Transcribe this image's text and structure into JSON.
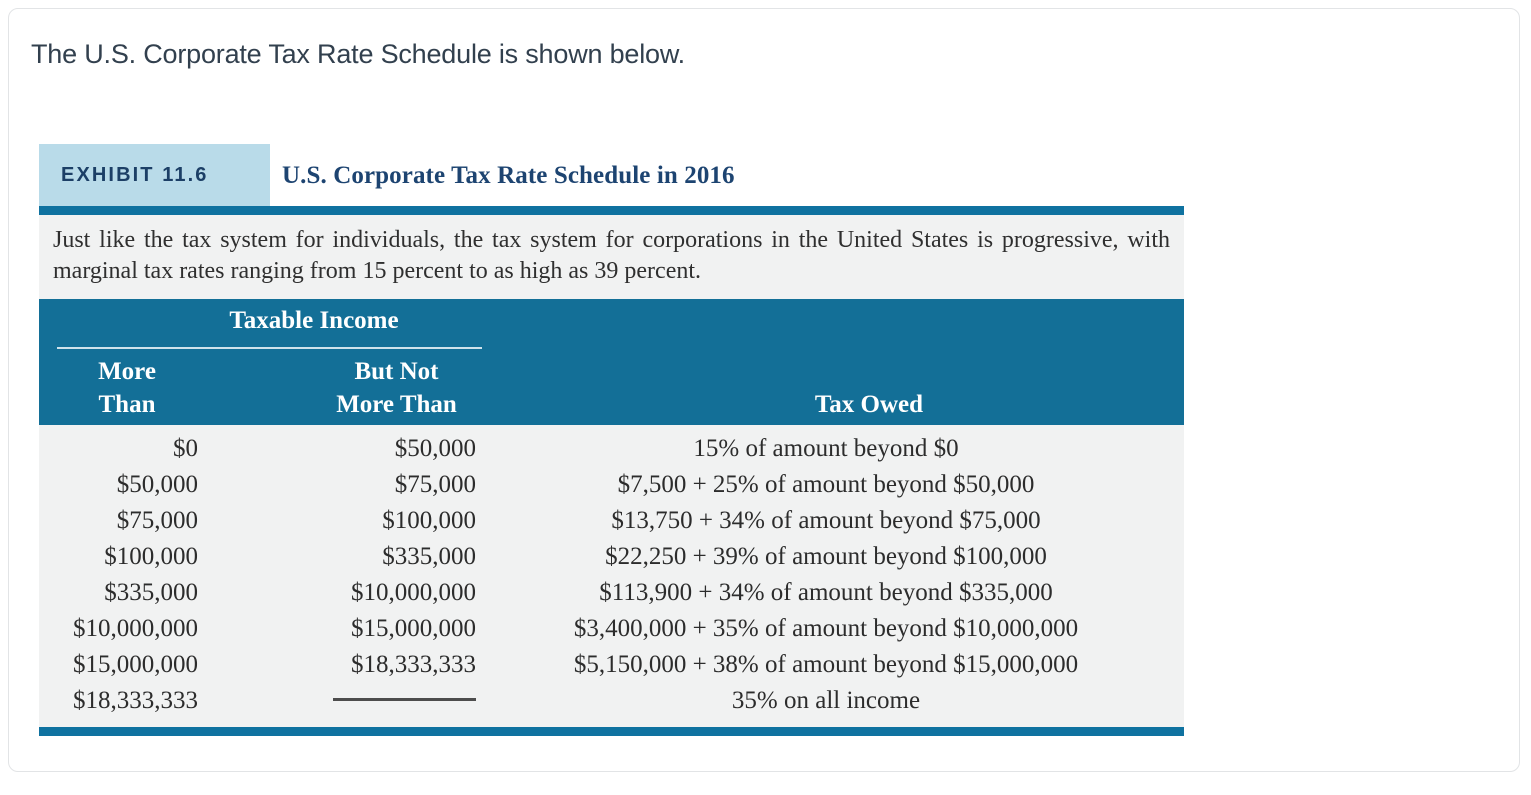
{
  "prompt": "The U.S. Corporate Tax Rate Schedule is shown below.",
  "exhibit": {
    "tag": "EXHIBIT 11.6",
    "title": "U.S. Corporate Tax Rate Schedule in 2016",
    "description": "Just like the tax system for individuals, the tax system for corporations in the United States is progressive, with marginal tax rates ranging from 15 percent to as high as 39 percent.",
    "colors": {
      "tag_background": "#b9dbe9",
      "tag_text": "#1c3f66",
      "title_text": "#1d4471",
      "rule_blue": "#0f72a0",
      "table_head_background": "#136f97",
      "table_body_background": "#f1f2f2",
      "prompt_text": "#32404e"
    },
    "table": {
      "group_header": "Taxable Income",
      "columns": [
        {
          "line1": "More",
          "line2": "Than"
        },
        {
          "line1": "But Not",
          "line2": "More Than"
        },
        {
          "line1": "",
          "line2": "Tax Owed"
        }
      ],
      "rows": [
        {
          "more_than": "$0",
          "but_not_more_than": "$50,000",
          "tax_owed": "15% of amount beyond $0"
        },
        {
          "more_than": "$50,000",
          "but_not_more_than": "$75,000",
          "tax_owed": "$7,500 + 25% of amount beyond $50,000"
        },
        {
          "more_than": "$75,000",
          "but_not_more_than": "$100,000",
          "tax_owed": "$13,750 + 34% of amount beyond $75,000"
        },
        {
          "more_than": "$100,000",
          "but_not_more_than": "$335,000",
          "tax_owed": "$22,250 + 39% of amount beyond $100,000"
        },
        {
          "more_than": "$335,000",
          "but_not_more_than": "$10,000,000",
          "tax_owed": "$113,900 + 34% of amount beyond $335,000"
        },
        {
          "more_than": "$10,000,000",
          "but_not_more_than": "$15,000,000",
          "tax_owed": "$3,400,000 + 35% of amount beyond $10,000,000"
        },
        {
          "more_than": "$15,000,000",
          "but_not_more_than": "$18,333,333",
          "tax_owed": "$5,150,000 + 38% of amount beyond $15,000,000"
        },
        {
          "more_than": "$18,333,333",
          "but_not_more_than": "",
          "tax_owed": "35% on all income"
        }
      ]
    }
  }
}
